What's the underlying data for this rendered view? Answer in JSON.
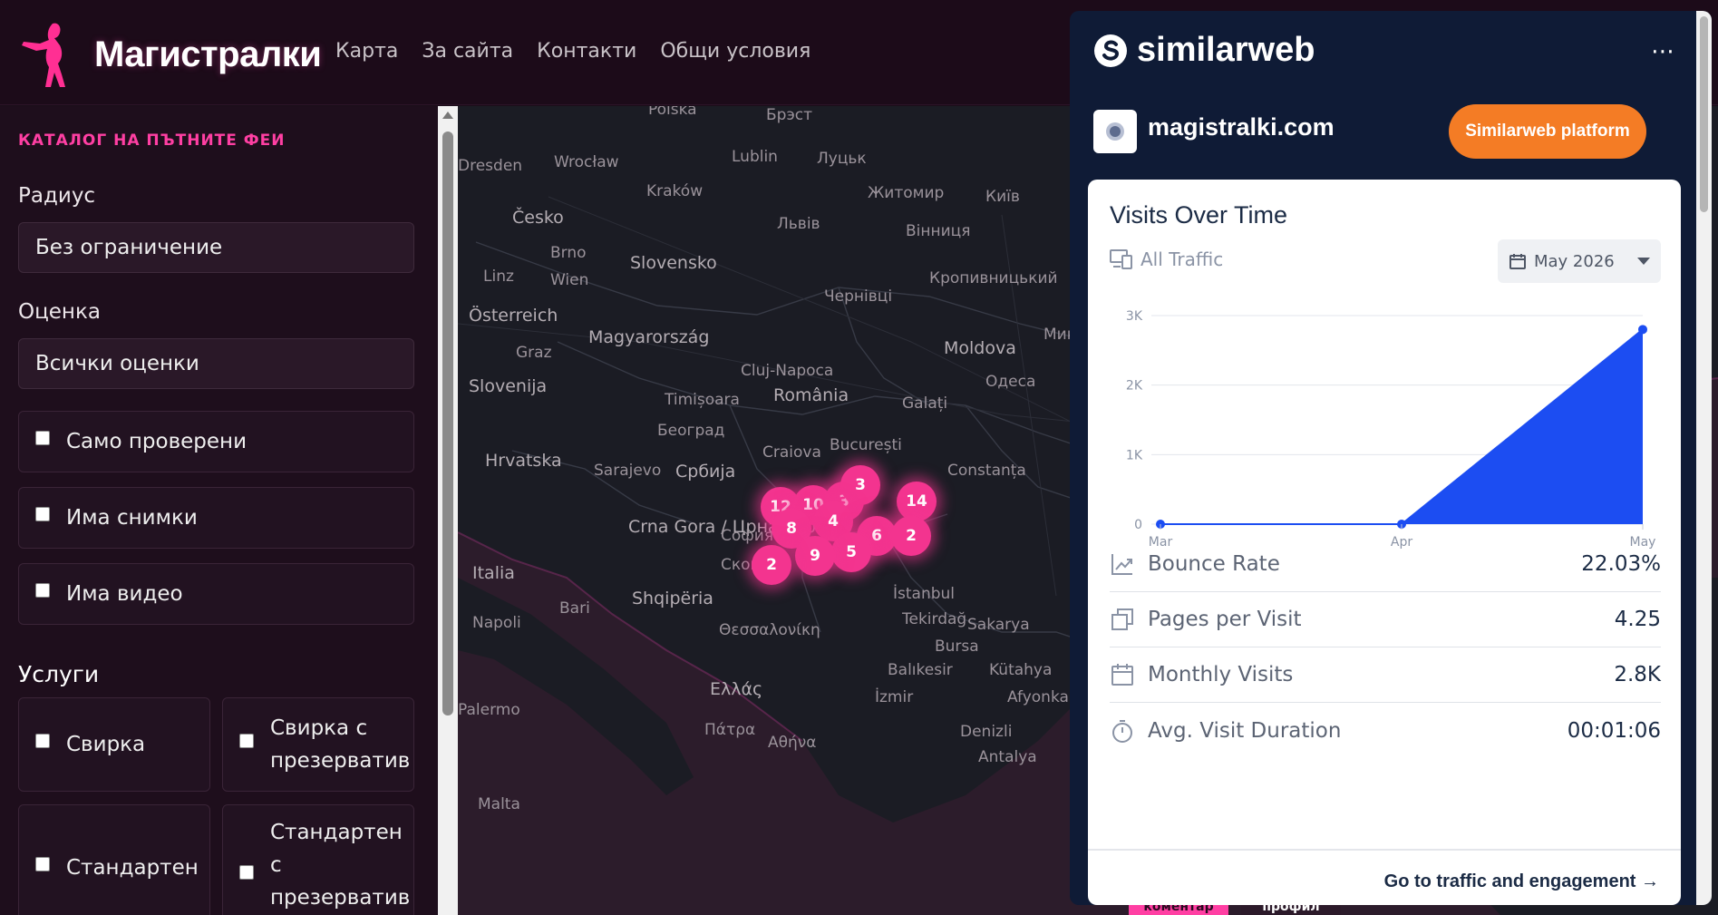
{
  "header": {
    "brand": "Магистралки",
    "nav": [
      "Карта",
      "За сайта",
      "Контакти",
      "Общи условия"
    ]
  },
  "sidebar": {
    "title": "КАТАЛОГ НА ПЪТНИТЕ ФЕИ",
    "radius_label": "Радиус",
    "radius_value": "Без ограничение",
    "rating_label": "Оценка",
    "rating_value": "Всички оценки",
    "checks": [
      "Само проверени",
      "Има снимки",
      "Има видео"
    ],
    "services_heading": "Услуги",
    "services": [
      "Свирка",
      "Свирка с презерватив",
      "Стандартен",
      "Стандартен с презерватив"
    ]
  },
  "map": {
    "countries": [
      "Česko",
      "Slovensko",
      "Österreich",
      "Magyarország",
      "Slovenija",
      "Hrvatska",
      "România",
      "Moldova",
      "Србија",
      "Crna Gora / Црна Гора",
      "Shqipëria",
      "Italia",
      "Ελλάς"
    ],
    "cities": [
      "Polska",
      "Брэст",
      "Dresden",
      "Wrocław",
      "Lublin",
      "Луцьк",
      "Житомир",
      "Київ",
      "Kraków",
      "Львів",
      "Вінниця",
      "Linz",
      "Brno",
      "Wien",
      "Чернівці",
      "Кропивницький",
      "Миколаїв",
      "Graz",
      "Cluj-Napoca",
      "Одеса",
      "Timișoara",
      "Galați",
      "Београд",
      "Craiova",
      "București",
      "Constanța",
      "Sarajevo",
      "София",
      "Скопје",
      "Bari",
      "Napoli",
      "İstanbul",
      "Tekirdağ",
      "Sakarya",
      "Θεσσαλονίκη",
      "Bursa",
      "Balıkesir",
      "Kütahya",
      "İzmir",
      "Afyonkarahisar",
      "Πάτρα",
      "Αθήνα",
      "Denizli",
      "Antalya",
      "Malta",
      "Palermo"
    ],
    "clusters": [
      "12",
      "10",
      "3",
      "3",
      "4",
      "8",
      "14",
      "6",
      "2",
      "5",
      "9",
      "2"
    ],
    "bottom_labels": [
      "коментар",
      "профил"
    ]
  },
  "similarweb": {
    "brand": "similarweb",
    "more": "⋯",
    "site": "magistralki.com",
    "platform_button": "Similarweb platform",
    "card_title": "Visits Over Time",
    "traffic_label": "All Traffic",
    "date": "May 2026",
    "metrics": [
      {
        "label": "Bounce Rate",
        "value": "22.03%"
      },
      {
        "label": "Pages per Visit",
        "value": "4.25"
      },
      {
        "label": "Monthly Visits",
        "value": "2.8K"
      },
      {
        "label": "Avg. Visit Duration",
        "value": "00:01:06"
      }
    ],
    "link": "Go to traffic and engagement →"
  },
  "chart_data": {
    "type": "area",
    "x": [
      "Mar",
      "Apr",
      "May"
    ],
    "series": [
      {
        "values": [
          0,
          0,
          2800
        ]
      }
    ],
    "yticks": [
      "0",
      "1K",
      "2K",
      "3K"
    ],
    "ylim": [
      0,
      3000
    ],
    "color": "#1c4df2",
    "grid": true
  }
}
